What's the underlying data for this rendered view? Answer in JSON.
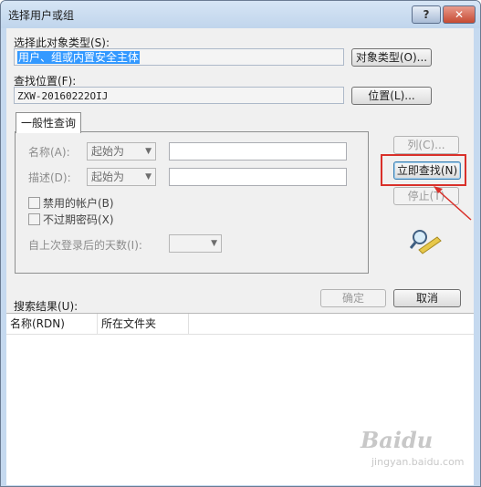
{
  "window": {
    "title": "选择用户或组",
    "help_button": "?",
    "close_button": "✕"
  },
  "object_type": {
    "label": "选择此对象类型(S):",
    "value": "用户、组或内置安全主体",
    "button": "对象类型(O)..."
  },
  "location": {
    "label": "查找位置(F):",
    "value": "ZXW-20160222OIJ",
    "button": "位置(L)..."
  },
  "tab": {
    "label": "一般性查询"
  },
  "query": {
    "name_label": "名称(A):",
    "name_combo": "起始为",
    "desc_label": "描述(D):",
    "desc_combo": "起始为",
    "disabled_accounts": "禁用的帐户(B)",
    "no_expire_pwd": "不过期密码(X)",
    "days_since_login": "自上次登录后的天数(I):"
  },
  "side_buttons": {
    "columns": "列(C)...",
    "find_now": "立即查找(N)",
    "stop": "停止(T)"
  },
  "footer": {
    "search_results_label": "搜索结果(U):",
    "ok": "确定",
    "cancel": "取消"
  },
  "results_table": {
    "columns": [
      "名称(RDN)",
      "所在文件夹"
    ]
  },
  "watermark": {
    "brand": "Baidu",
    "sub": "jingyan.baidu.com"
  },
  "colors": {
    "highlight": "#d9302a",
    "selection": "#3399ff"
  }
}
